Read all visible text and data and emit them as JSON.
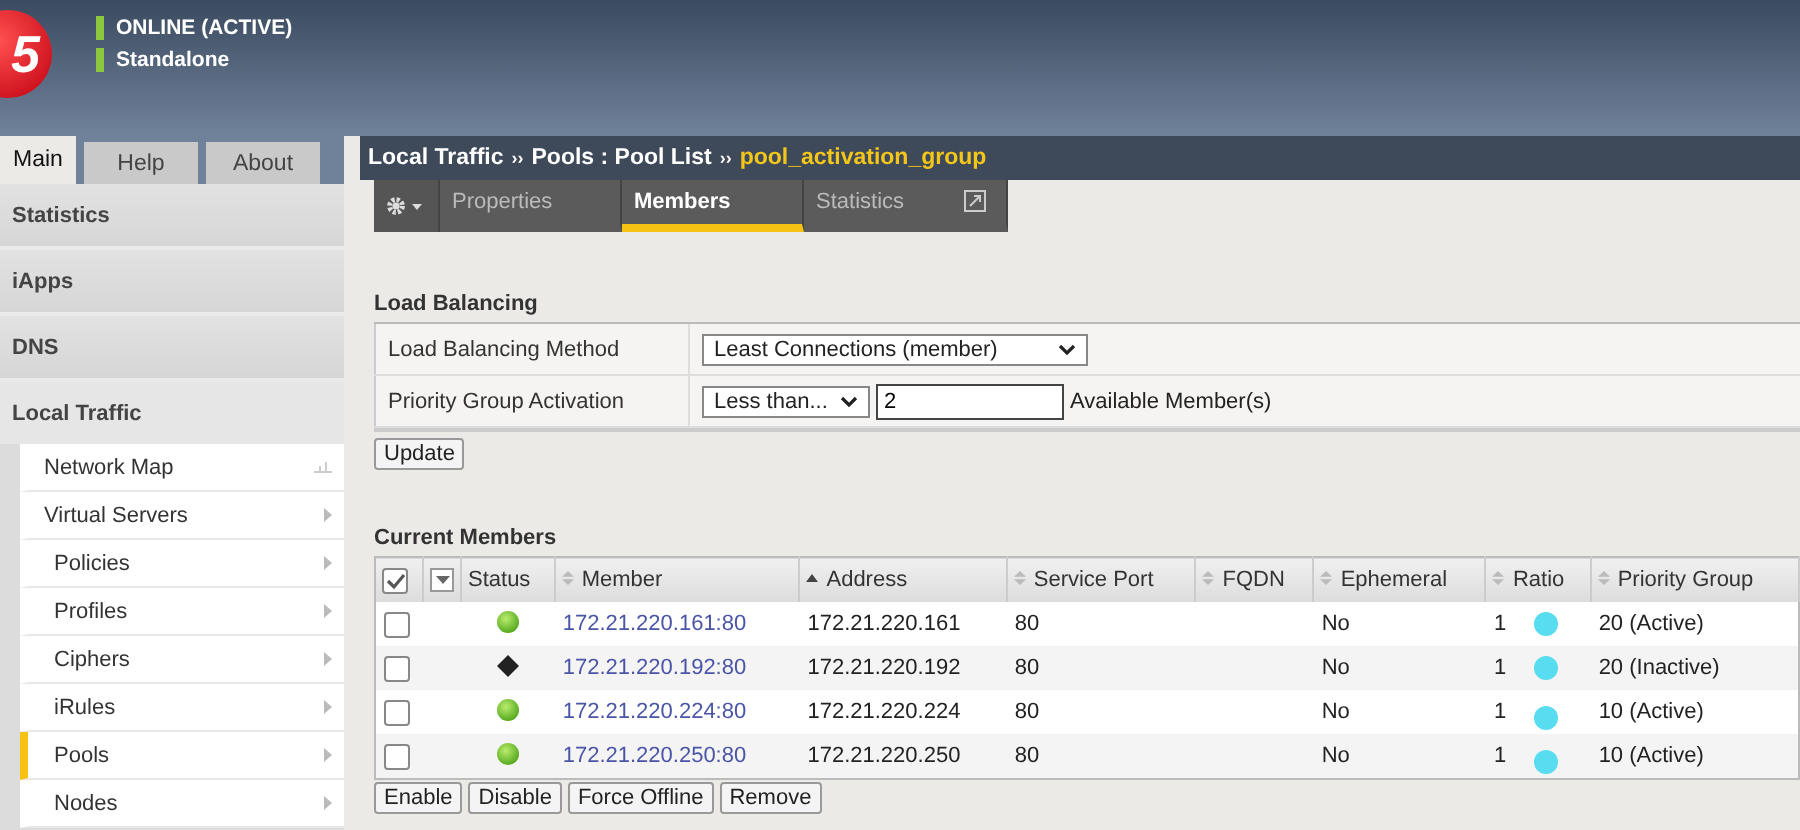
{
  "header": {
    "logo": "5",
    "status_lines": [
      {
        "text": "ONLINE (ACTIVE)",
        "color": "#8dc63f"
      },
      {
        "text": "Standalone",
        "color": "#8dc63f"
      }
    ]
  },
  "main_tabs": [
    {
      "label": "Main",
      "selected": true
    },
    {
      "label": "Help",
      "selected": false
    },
    {
      "label": "About",
      "selected": false
    }
  ],
  "sidebar": {
    "sections": [
      {
        "label": "Statistics",
        "expanded": false
      },
      {
        "label": "iApps",
        "expanded": false
      },
      {
        "label": "DNS",
        "expanded": false
      },
      {
        "label": "Local Traffic",
        "expanded": true
      }
    ],
    "items": [
      {
        "label": "Network Map",
        "kind": "link",
        "selected": false
      },
      {
        "label": "Virtual Servers",
        "kind": "menu",
        "selected": false,
        "children": [
          {
            "label": "Policies",
            "kind": "menu",
            "selected": false
          },
          {
            "label": "Profiles",
            "kind": "menu",
            "selected": false
          },
          {
            "label": "Ciphers",
            "kind": "menu",
            "selected": false
          },
          {
            "label": "iRules",
            "kind": "menu",
            "selected": false
          },
          {
            "label": "Pools",
            "kind": "menu",
            "selected": true
          },
          {
            "label": "Nodes",
            "kind": "menu",
            "selected": false
          }
        ]
      }
    ]
  },
  "breadcrumb": {
    "parts": [
      "Local Traffic",
      "Pools : Pool List"
    ],
    "current": "pool_activation_group",
    "separator": "››"
  },
  "page_tabs": [
    {
      "label": "Properties",
      "selected": false,
      "popout": false
    },
    {
      "label": "Members",
      "selected": true,
      "popout": false
    },
    {
      "label": "Statistics",
      "selected": false,
      "popout": true
    }
  ],
  "load_balancing": {
    "title": "Load Balancing",
    "method_label": "Load Balancing Method",
    "method_value": "Least Connections (member)",
    "activation_label": "Priority Group Activation",
    "activation_value": "Less than...",
    "activation_count": "2",
    "activation_suffix": "Available Member(s)",
    "update_button": "Update"
  },
  "members": {
    "title": "Current Members",
    "header_checked": true,
    "columns": [
      "Status",
      "Member",
      "Address",
      "Service Port",
      "FQDN",
      "Ephemeral",
      "Ratio",
      "Priority Group"
    ],
    "rows": [
      {
        "checked": false,
        "kind": "available",
        "member": "172.21.220.161:80",
        "address": "172.21.220.161",
        "port": "80",
        "ephemeral": "No",
        "ratio": "1",
        "priority": "20  (Active)"
      },
      {
        "checked": false,
        "kind": "unknown",
        "member": "172.21.220.192:80",
        "address": "172.21.220.192",
        "port": "80",
        "ephemeral": "No",
        "ratio": "1",
        "priority": "20  (Inactive)"
      },
      {
        "checked": false,
        "kind": "available",
        "member": "172.21.220.224:80",
        "address": "172.21.220.224",
        "port": "80",
        "ephemeral": "No",
        "ratio": "1",
        "priority": "10  (Active)"
      },
      {
        "checked": false,
        "kind": "available",
        "member": "172.21.220.250:80",
        "address": "172.21.220.250",
        "port": "80",
        "ephemeral": "No",
        "ratio": "1",
        "priority": "10  (Active)"
      }
    ],
    "buttons": [
      "Enable",
      "Disable",
      "Force Offline",
      "Remove"
    ]
  }
}
